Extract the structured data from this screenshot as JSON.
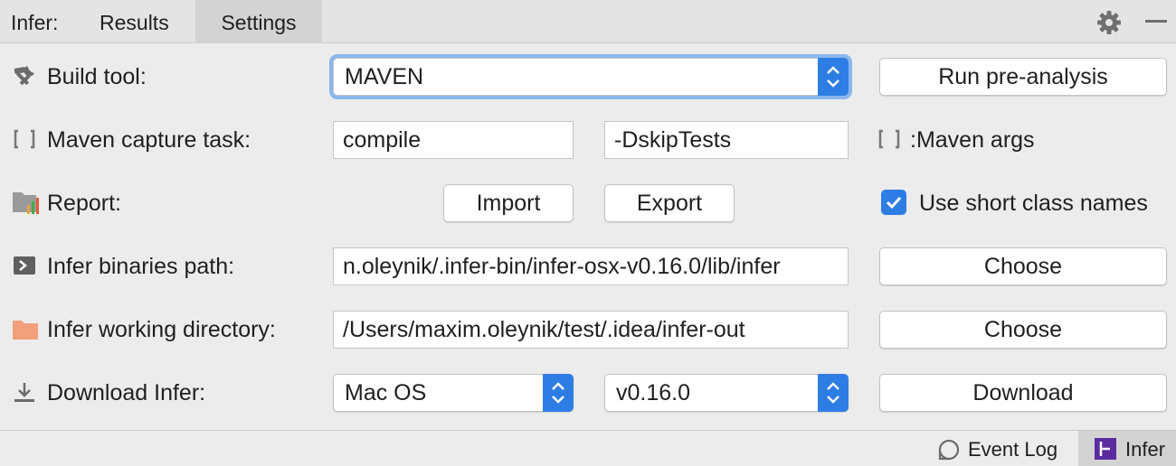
{
  "tabbar": {
    "title": "Infer:",
    "tabs": [
      {
        "label": "Results",
        "selected": false
      },
      {
        "label": "Settings",
        "selected": true
      }
    ]
  },
  "rows": {
    "build_tool": {
      "label": "Build tool:",
      "icon": "wrench-hammer-icon",
      "select_value": "MAVEN",
      "button": "Run pre-analysis"
    },
    "capture": {
      "label": "Maven capture task:",
      "icon": "bracket-icon",
      "task_value": "compile",
      "args_value": "-DskipTests",
      "args_label": ":Maven args"
    },
    "report": {
      "label": "Report:",
      "icon": "report-folder-icon",
      "import_label": "Import",
      "export_label": "Export",
      "short_names_label": "Use short class names",
      "short_names_checked": true
    },
    "binaries": {
      "label": "Infer binaries path:",
      "icon": "terminal-icon",
      "value": "n.oleynik/.infer-bin/infer-osx-v0.16.0/lib/infer",
      "button": "Choose"
    },
    "working_dir": {
      "label": "Infer working directory:",
      "icon": "folder-icon",
      "value": "/Users/maxim.oleynik/test/.idea/infer-out",
      "button": "Choose"
    },
    "download": {
      "label": "Download Infer:",
      "icon": "download-icon",
      "os_value": "Mac OS",
      "version_value": "v0.16.0",
      "button": "Download"
    }
  },
  "statusbar": {
    "event_log": "Event Log",
    "infer": "Infer"
  },
  "colors": {
    "accent": "#2e7de5",
    "focus_ring": "#8ab7ee",
    "folder": "#f2a07b",
    "infer_badge": "#5b2ca0"
  }
}
